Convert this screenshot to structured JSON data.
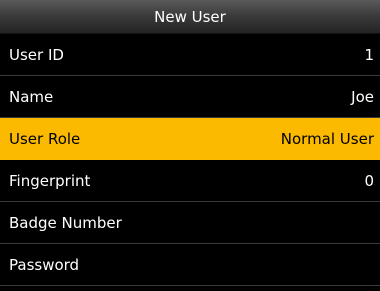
{
  "title": "New User",
  "menu": {
    "items": [
      {
        "label": "User ID",
        "value": "1"
      },
      {
        "label": "Name",
        "value": "Joe"
      },
      {
        "label": "User Role",
        "value": "Normal User"
      },
      {
        "label": "Fingerprint",
        "value": "0"
      },
      {
        "label": "Badge Number",
        "value": ""
      },
      {
        "label": "Password",
        "value": ""
      }
    ]
  },
  "colors": {
    "selected_background": "#fbb900",
    "background": "#000000",
    "text": "#ffffff"
  }
}
